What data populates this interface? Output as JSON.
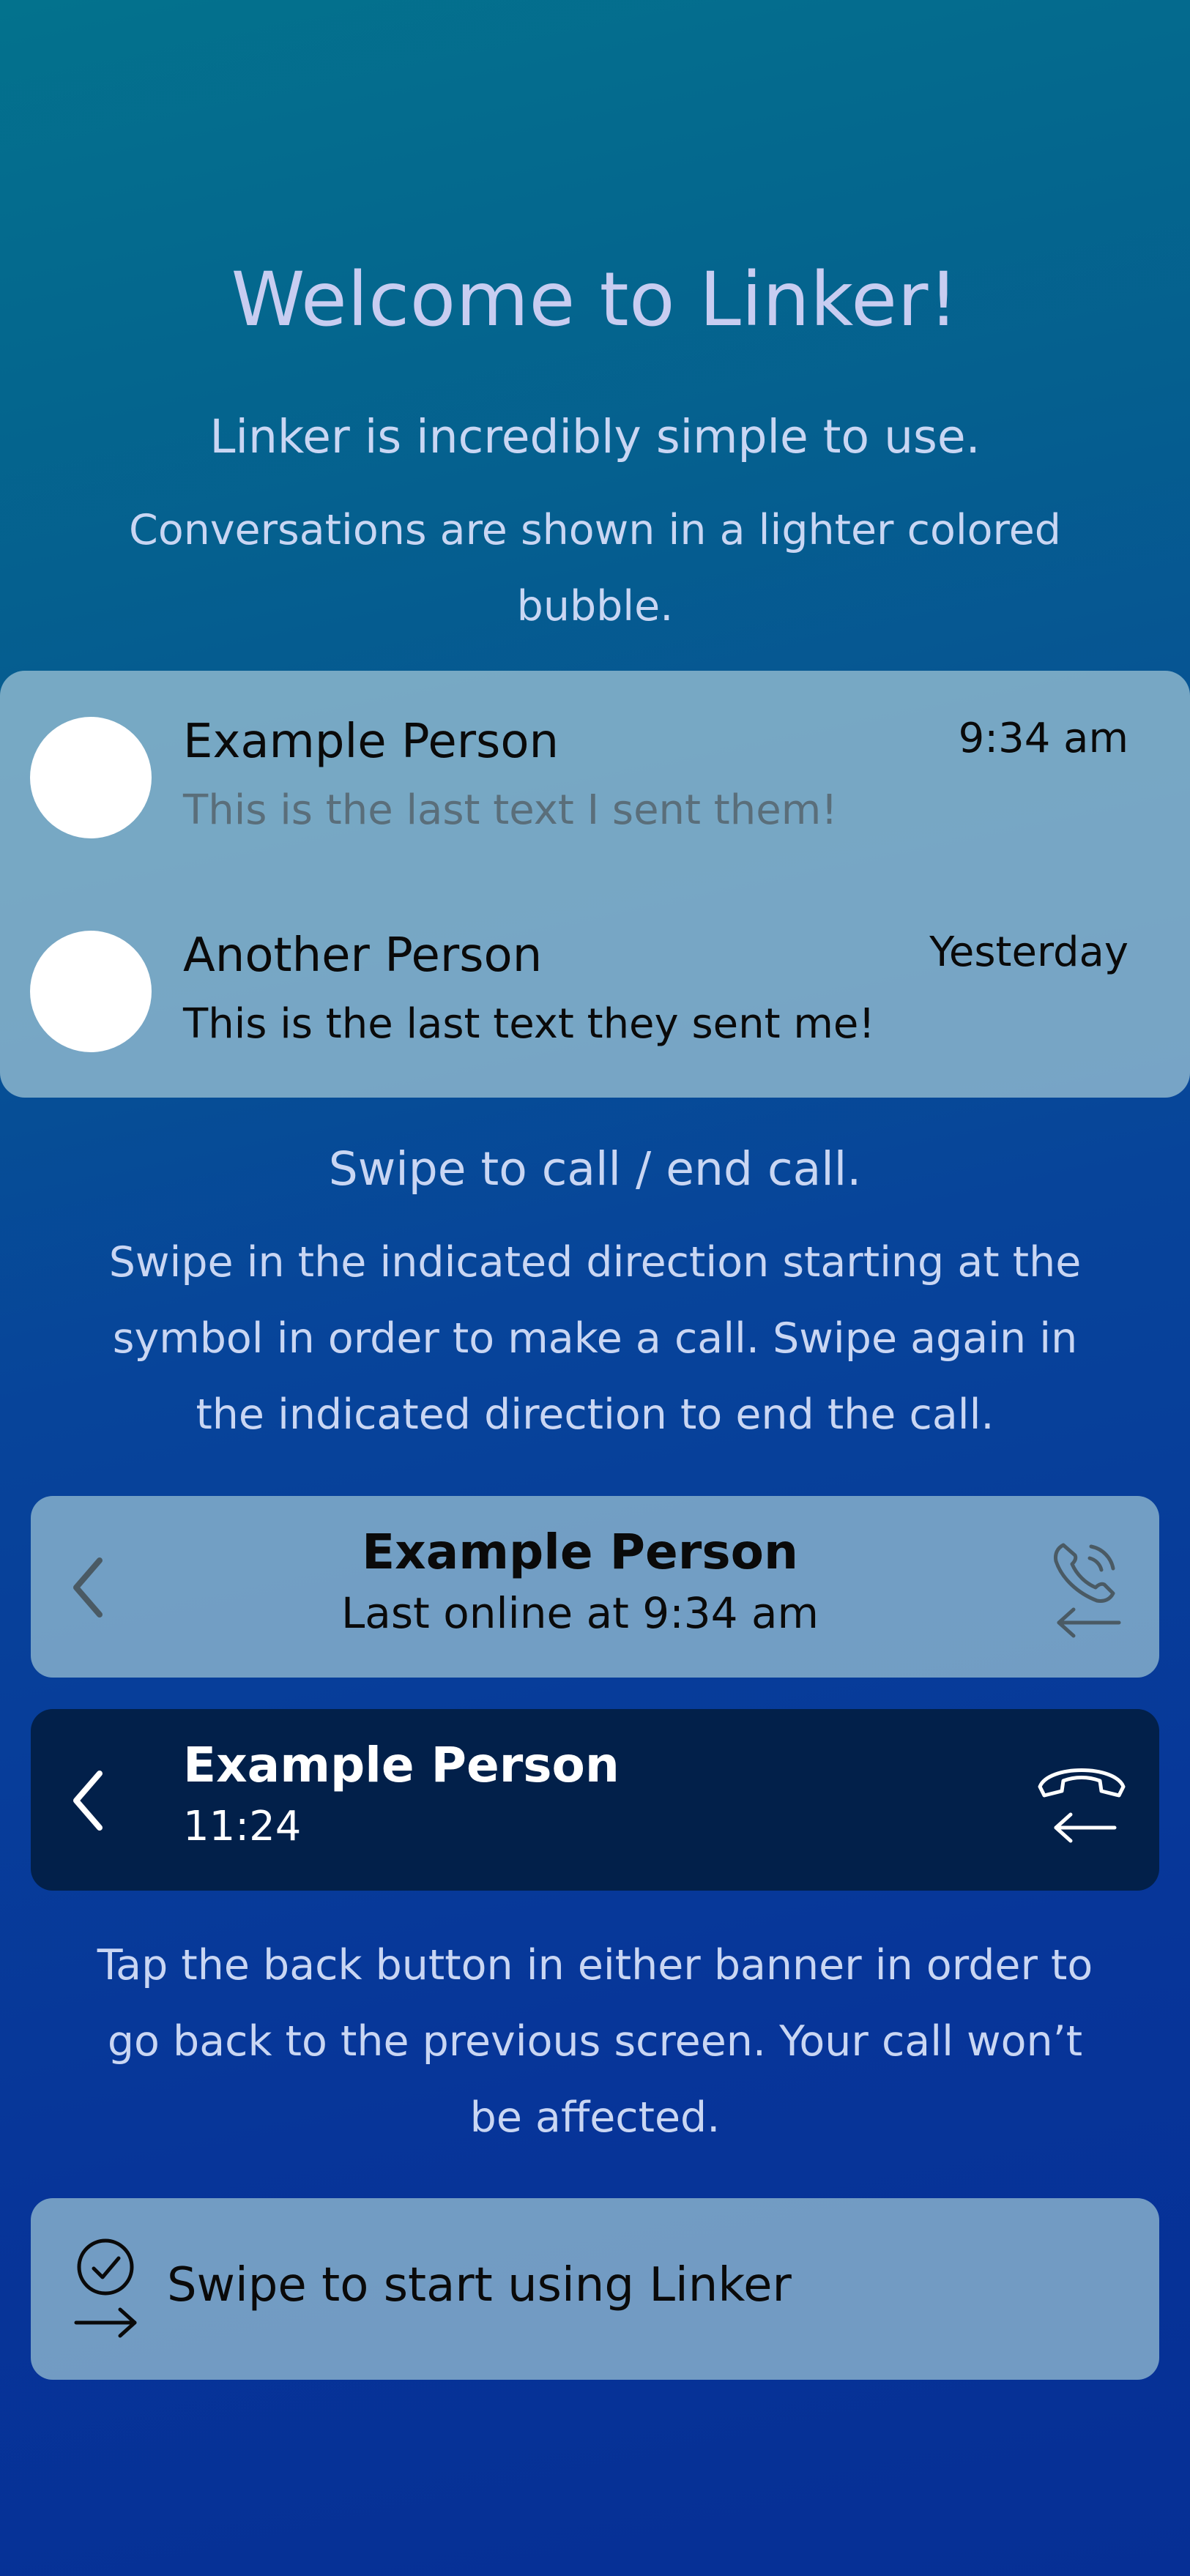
{
  "intro": {
    "title": "Welcome to Linker!",
    "subtitle": "Linker is incredibly simple to use.",
    "bubble_note": "Conversations are shown in a lighter colored bubble."
  },
  "conversations": [
    {
      "name": "Example Person",
      "time": "9:34 am",
      "message": "This is the last text I sent them!",
      "message_color": "#5a6e7a"
    },
    {
      "name": "Another Person",
      "time": "Yesterday",
      "message": "This is the last text they sent me!",
      "message_color": "#0a0a0a"
    }
  ],
  "swipe_section": {
    "heading": "Swipe to call / end call.",
    "description": "Swipe in the indicated direction starting at the symbol in order to make a call. Swipe again in the indicated direction to end the call."
  },
  "banner_idle": {
    "name": "Example Person",
    "status": "Last online at 9:34 am",
    "back_icon": "chevron-left-icon",
    "call_icon": "phone-call-swipe-left-icon"
  },
  "banner_active": {
    "name": "Example Person",
    "timer": "11:24",
    "back_icon": "chevron-left-icon",
    "end_icon": "hang-up-swipe-left-icon"
  },
  "back_note": "Tap the back button in either banner in order to go back to the previous screen. Your call won’t be affected.",
  "start": {
    "label": "Swipe to start using Linker",
    "icon": "check-circle-arrow-right-icon"
  },
  "colors": {
    "background_top": "#03728d",
    "background_bottom": "#062f95",
    "light_panel": "#97bfd2",
    "dark_banner": "#02204a",
    "heading_text": "#c8cdf1"
  }
}
